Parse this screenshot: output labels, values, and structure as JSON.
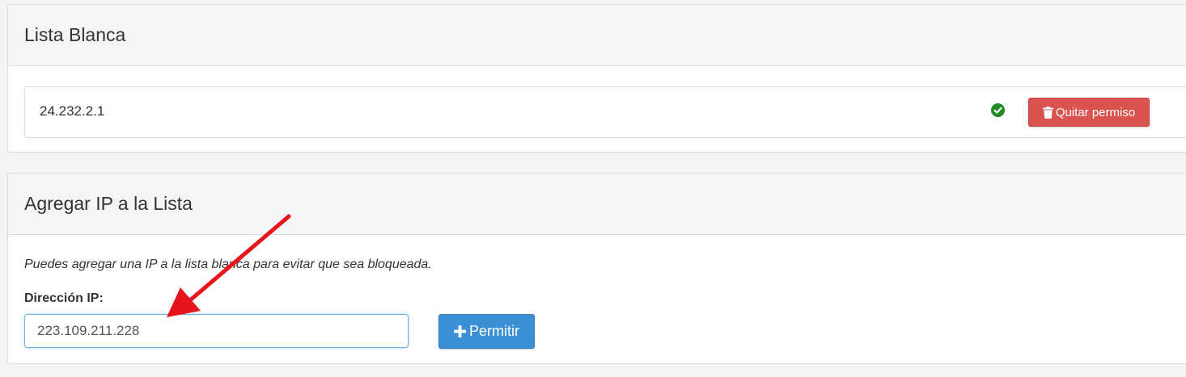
{
  "whitelist_panel": {
    "title": "Lista Blanca",
    "entries": [
      {
        "ip": "24.232.2.1",
        "status_icon": "check-circle-icon",
        "status_color": "#1e8c1e",
        "remove_label": "Quitar permiso",
        "remove_icon": "trash-icon"
      }
    ]
  },
  "add_panel": {
    "title": "Agregar IP a la Lista",
    "help_text": "Puedes agregar una IP a la lista blanca para evitar que sea bloqueada.",
    "ip_label": "Dirección IP:",
    "ip_value": "223.109.211.228",
    "permit_label": "Permitir",
    "permit_icon": "plus-icon"
  },
  "colors": {
    "danger": "#d9534f",
    "primary": "#3b8fd4",
    "annotation_arrow": "#e8141c"
  }
}
